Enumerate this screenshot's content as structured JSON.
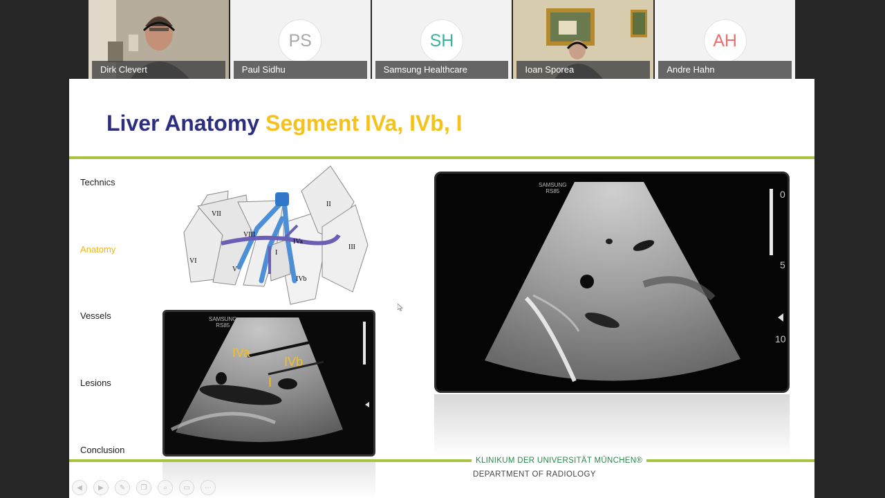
{
  "participants": [
    {
      "name": "Dirk Clevert",
      "type": "video"
    },
    {
      "name": "Paul Sidhu",
      "initials": "PS",
      "initials_color": "#a8a8a8"
    },
    {
      "name": "Samsung Healthcare",
      "initials": "SH",
      "initials_color": "#3bb19c"
    },
    {
      "name": "Ioan Sporea",
      "type": "video"
    },
    {
      "name": "Andre Hahn",
      "initials": "AH",
      "initials_color": "#e9706d"
    }
  ],
  "slide": {
    "title_part1": "Liver Anatomy",
    "title_part2": "Segment IVa, IVb, I",
    "nav": [
      "Technics",
      "Anatomy",
      "Vessels",
      "Lesions",
      "Conclusion"
    ],
    "active_nav": "Anatomy",
    "anatomy_labels": [
      "VII",
      "VIII",
      "II",
      "IVa",
      "III",
      "I",
      "VI",
      "V",
      "IVb"
    ],
    "us_brand": "SAMSUNG",
    "us_model": "RS85",
    "small_us_labels": [
      "IVa",
      "IVb",
      "I"
    ],
    "large_scale": [
      "0",
      "5",
      "10"
    ],
    "footer_main": "KLINIKUM DER UNIVERSITÄT MÜNCHEN®",
    "footer_sub": "DEPARTMENT OF RADIOLOGY"
  },
  "colors": {
    "accent_rule": "#a6c43f",
    "title_blue": "#2d2f7e",
    "title_yellow": "#f4c11e",
    "footer_green": "#26874a"
  },
  "controls": [
    "back-icon",
    "forward-icon",
    "pen-icon",
    "copy-icon",
    "zoom-icon",
    "screen-icon",
    "more-icon"
  ]
}
